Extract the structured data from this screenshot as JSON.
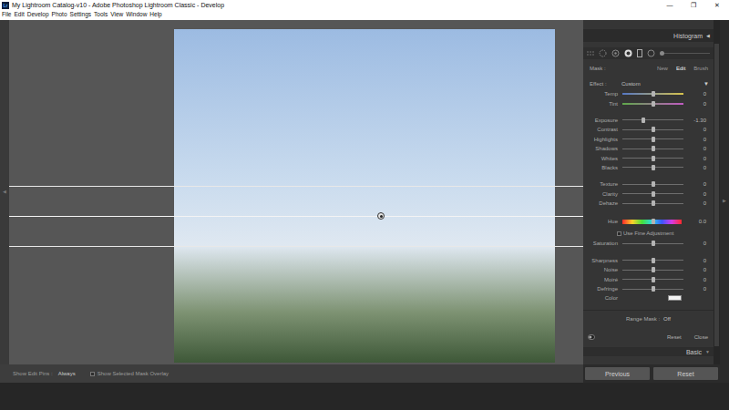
{
  "window": {
    "logo": "Lr",
    "title": "My Lightroom Catalog-v10 - Adobe Photoshop Lightroom Classic - Develop",
    "controls": [
      "—",
      "❐",
      "✕"
    ]
  },
  "menu": [
    "File",
    "Edit",
    "Develop",
    "Photo",
    "Settings",
    "Tools",
    "View",
    "Window",
    "Help"
  ],
  "canvas": {
    "left_toggle": "◀",
    "right_toggle": "▶"
  },
  "toolbar": {
    "edit_pins_label": "Show Edit Pins :",
    "edit_pins_value": "Always",
    "overlay": {
      "label": "Show Selected Mask Overlay",
      "checked": false
    }
  },
  "panel": {
    "header": "Histogram",
    "header_toggle": "◀",
    "mask": {
      "label": "Mask :",
      "tabs": [
        {
          "label": "New",
          "selected": false
        },
        {
          "label": "Edit",
          "selected": true
        },
        {
          "label": "Brush",
          "selected": false
        }
      ]
    },
    "effect": {
      "label": "Effect :",
      "value": "Custom",
      "toggle": "▼"
    },
    "groups": [
      [
        {
          "kind": "slider",
          "label": "Temp",
          "level": 0.5,
          "reading": "0",
          "colors": [
            "#5577c4",
            "#d6c24c"
          ]
        },
        {
          "kind": "slider",
          "label": "Tint",
          "level": 0.5,
          "reading": "0",
          "colors": [
            "#5fa84a",
            "#c05ac2"
          ]
        }
      ],
      [
        {
          "kind": "slider",
          "label": "Exposure",
          "level": 0.34,
          "reading": "-1.30"
        },
        {
          "kind": "slider",
          "label": "Contrast",
          "level": 0.5,
          "reading": "0"
        },
        {
          "kind": "slider",
          "label": "Highlights",
          "level": 0.5,
          "reading": "0"
        },
        {
          "kind": "slider",
          "label": "Shadows",
          "level": 0.5,
          "reading": "0"
        },
        {
          "kind": "slider",
          "label": "Whites",
          "level": 0.5,
          "reading": "0"
        },
        {
          "kind": "slider",
          "label": "Blacks",
          "level": 0.5,
          "reading": "0"
        }
      ],
      [
        {
          "kind": "slider",
          "label": "Texture",
          "level": 0.5,
          "reading": "0"
        },
        {
          "kind": "slider",
          "label": "Clarity",
          "level": 0.5,
          "reading": "0"
        },
        {
          "kind": "slider",
          "label": "Dehaze",
          "level": 0.5,
          "reading": "0"
        }
      ],
      [
        {
          "kind": "hue",
          "label": "Hue",
          "level": 0.5,
          "reading": "0.0"
        },
        {
          "kind": "checkbox",
          "label": "Use Fine Adjustment",
          "checked": false
        },
        {
          "kind": "slider",
          "label": "Saturation",
          "level": 0.5,
          "reading": "0"
        }
      ],
      [
        {
          "kind": "slider",
          "label": "Sharpness",
          "level": 0.5,
          "reading": "0"
        },
        {
          "kind": "slider",
          "label": "Noise",
          "level": 0.5,
          "reading": "0"
        },
        {
          "kind": "slider",
          "label": "Moiré",
          "level": 0.5,
          "reading": "0"
        },
        {
          "kind": "slider",
          "label": "Defringe",
          "level": 0.5,
          "reading": "0"
        },
        {
          "kind": "color",
          "label": "Color",
          "color": "#f2f2f2"
        }
      ]
    ],
    "range_mask": {
      "label": "Range Mask :",
      "value": "Off"
    },
    "footer_buttons": [
      "Reset",
      "Close"
    ],
    "next_section": {
      "label": "Basic",
      "toggle": "▼"
    }
  },
  "buttons": [
    "Previous",
    "Reset"
  ]
}
